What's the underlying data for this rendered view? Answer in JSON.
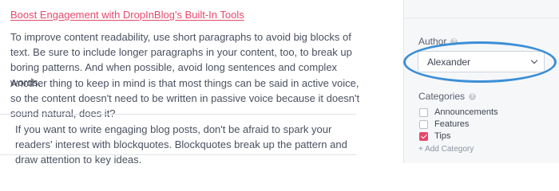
{
  "editor": {
    "post_link": "Boost Engagement with DropInBlog's Built-In Tools",
    "paragraph_1": "To improve content readability, use short paragraphs to avoid big blocks of text. Be sure to include longer paragraphs in your content, too, to break up boring patterns. And when possible, avoid long sentences and complex words.",
    "paragraph_2": "Another thing to keep in mind is that most things can be said in active voice, so the content doesn't need to be written in passive voice because it doesn't sound natural, does it?",
    "blockquote": "If you want to write engaging blog posts, don't be afraid to spark your readers' interest with blockquotes. Blockquotes break up the pattern and draw attention to key ideas."
  },
  "sidebar": {
    "author_label": "Author",
    "author_value": "Alexander",
    "categories_label": "Categories",
    "categories": [
      {
        "label": "Announcements",
        "checked": false
      },
      {
        "label": "Features",
        "checked": false
      },
      {
        "label": "Tips",
        "checked": true
      }
    ],
    "add_category": "+ Add Category"
  },
  "colors": {
    "accent": "#e5486b",
    "highlight_ring": "#3b8fd6",
    "sidebar_bg": "#f6f7f9"
  }
}
